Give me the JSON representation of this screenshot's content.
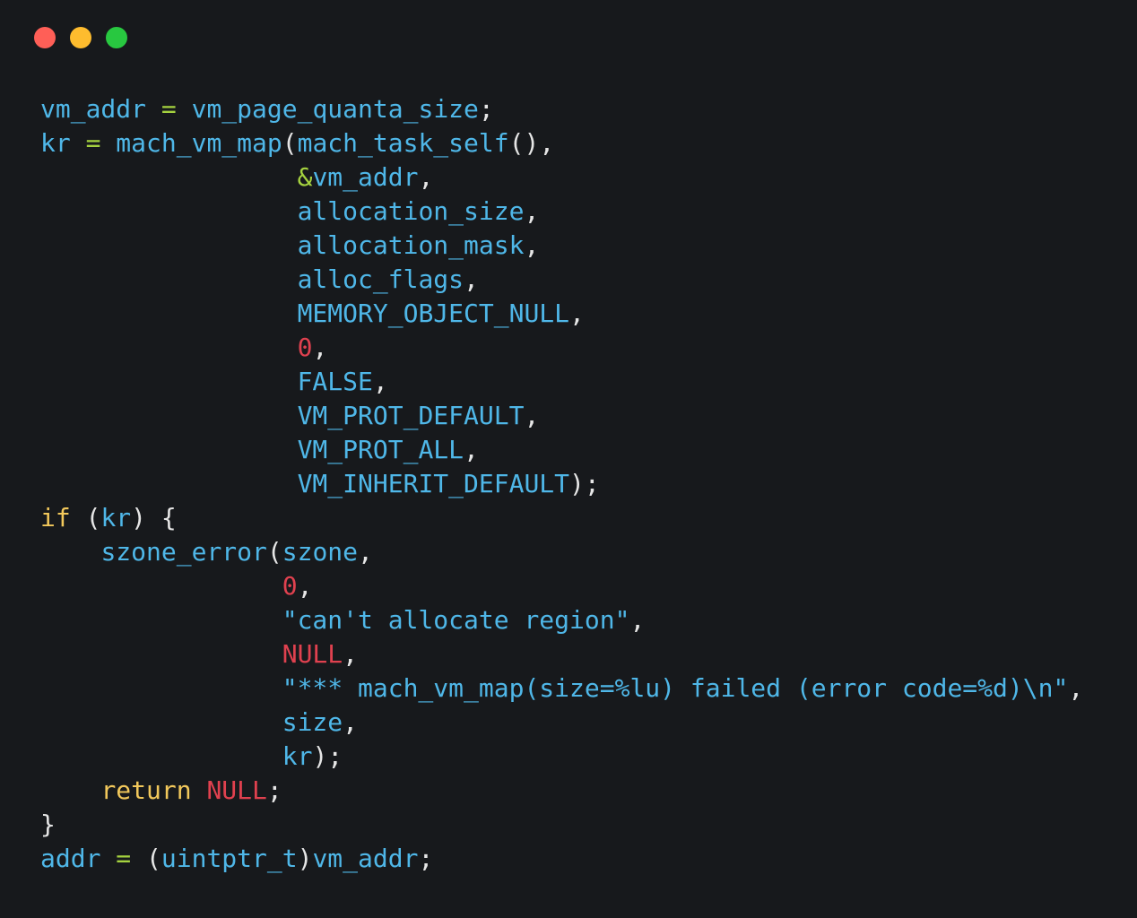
{
  "window": {
    "controls": [
      {
        "name": "close",
        "color": "#ff5f57"
      },
      {
        "name": "minimize",
        "color": "#febc2e"
      },
      {
        "name": "zoom",
        "color": "#28c840"
      }
    ]
  },
  "colors": {
    "background": "#17191c",
    "identifier": "#4fb7e8",
    "operator": "#a5d23f",
    "number_null": "#e0414f",
    "keyword": "#f2c85b",
    "punctuation": "#e6e6e6"
  },
  "code": {
    "lines": [
      [
        [
          "ident",
          "vm_addr"
        ],
        [
          "punc",
          " "
        ],
        [
          "op",
          "="
        ],
        [
          "punc",
          " "
        ],
        [
          "ident",
          "vm_page_quanta_size"
        ],
        [
          "punc",
          ";"
        ]
      ],
      [
        [
          "ident",
          "kr"
        ],
        [
          "punc",
          " "
        ],
        [
          "op",
          "="
        ],
        [
          "punc",
          " "
        ],
        [
          "ident",
          "mach_vm_map"
        ],
        [
          "punc",
          "("
        ],
        [
          "ident",
          "mach_task_self"
        ],
        [
          "punc",
          "(),"
        ]
      ],
      [
        [
          "punc",
          "                 "
        ],
        [
          "op",
          "&"
        ],
        [
          "ident",
          "vm_addr"
        ],
        [
          "punc",
          ","
        ]
      ],
      [
        [
          "punc",
          "                 "
        ],
        [
          "ident",
          "allocation_size"
        ],
        [
          "punc",
          ","
        ]
      ],
      [
        [
          "punc",
          "                 "
        ],
        [
          "ident",
          "allocation_mask"
        ],
        [
          "punc",
          ","
        ]
      ],
      [
        [
          "punc",
          "                 "
        ],
        [
          "ident",
          "alloc_flags"
        ],
        [
          "punc",
          ","
        ]
      ],
      [
        [
          "punc",
          "                 "
        ],
        [
          "ident",
          "MEMORY_OBJECT_NULL"
        ],
        [
          "punc",
          ","
        ]
      ],
      [
        [
          "punc",
          "                 "
        ],
        [
          "num",
          "0"
        ],
        [
          "punc",
          ","
        ]
      ],
      [
        [
          "punc",
          "                 "
        ],
        [
          "ident",
          "FALSE"
        ],
        [
          "punc",
          ","
        ]
      ],
      [
        [
          "punc",
          "                 "
        ],
        [
          "ident",
          "VM_PROT_DEFAULT"
        ],
        [
          "punc",
          ","
        ]
      ],
      [
        [
          "punc",
          "                 "
        ],
        [
          "ident",
          "VM_PROT_ALL"
        ],
        [
          "punc",
          ","
        ]
      ],
      [
        [
          "punc",
          "                 "
        ],
        [
          "ident",
          "VM_INHERIT_DEFAULT"
        ],
        [
          "punc",
          ");"
        ]
      ],
      [
        [
          "kw",
          "if"
        ],
        [
          "punc",
          " ("
        ],
        [
          "ident",
          "kr"
        ],
        [
          "punc",
          ") {"
        ]
      ],
      [
        [
          "punc",
          "    "
        ],
        [
          "ident",
          "szone_error"
        ],
        [
          "punc",
          "("
        ],
        [
          "ident",
          "szone"
        ],
        [
          "punc",
          ","
        ]
      ],
      [
        [
          "punc",
          "                "
        ],
        [
          "num",
          "0"
        ],
        [
          "punc",
          ","
        ]
      ],
      [
        [
          "punc",
          "                "
        ],
        [
          "ident",
          "\"can't allocate region\""
        ],
        [
          "punc",
          ","
        ]
      ],
      [
        [
          "punc",
          "                "
        ],
        [
          "num",
          "NULL"
        ],
        [
          "punc",
          ","
        ]
      ],
      [
        [
          "punc",
          "                "
        ],
        [
          "ident",
          "\"*** mach_vm_map(size=%lu) failed (error code=%d)\\n\""
        ],
        [
          "punc",
          ","
        ]
      ],
      [
        [
          "punc",
          "                "
        ],
        [
          "ident",
          "size"
        ],
        [
          "punc",
          ","
        ]
      ],
      [
        [
          "punc",
          "                "
        ],
        [
          "ident",
          "kr"
        ],
        [
          "punc",
          ");"
        ]
      ],
      [
        [
          "punc",
          "    "
        ],
        [
          "kw",
          "return"
        ],
        [
          "punc",
          " "
        ],
        [
          "num",
          "NULL"
        ],
        [
          "punc",
          ";"
        ]
      ],
      [
        [
          "punc",
          "}"
        ]
      ],
      [
        [
          "ident",
          "addr"
        ],
        [
          "punc",
          " "
        ],
        [
          "op",
          "="
        ],
        [
          "punc",
          " ("
        ],
        [
          "ident",
          "uintptr_t"
        ],
        [
          "punc",
          ")"
        ],
        [
          "ident",
          "vm_addr"
        ],
        [
          "punc",
          ";"
        ]
      ]
    ]
  }
}
